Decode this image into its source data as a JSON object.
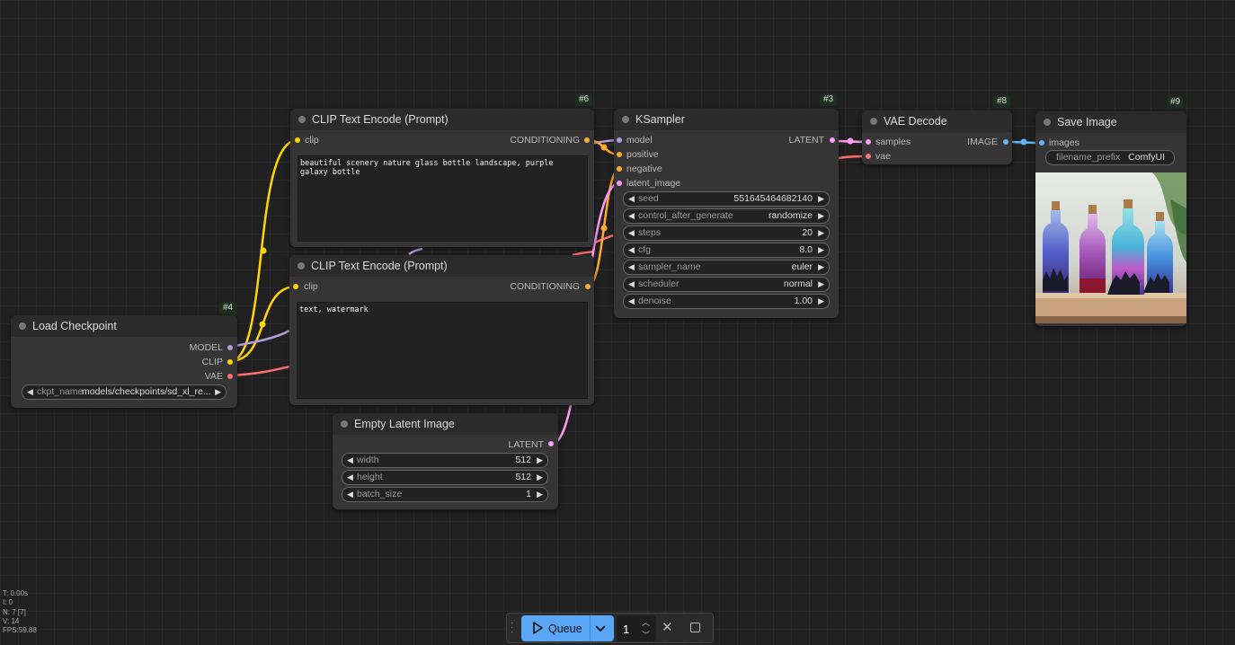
{
  "colors": {
    "model": "#b39ddb",
    "clip": "#ffd500",
    "vae": "#ff6e6e",
    "conditioning": "#ffa931",
    "latent": "#ff9cf9",
    "image": "#64b5f6",
    "queue_accent": "#58a6f5"
  },
  "nodes": {
    "load_checkpoint": {
      "badge": "#4",
      "title": "Load Checkpoint",
      "outputs": [
        "MODEL",
        "CLIP",
        "VAE"
      ],
      "ckpt_name_label": "ckpt_name",
      "ckpt_name_value": "models/checkpoints/sd_xl_re..."
    },
    "clip_pos": {
      "badge": "#6",
      "title": "CLIP Text Encode (Prompt)",
      "input": "clip",
      "output": "CONDITIONING",
      "text": "beautiful scenery nature glass bottle landscape, purple galaxy bottle"
    },
    "clip_neg": {
      "title": "CLIP Text Encode (Prompt)",
      "input": "clip",
      "output": "CONDITIONING",
      "text": "text, watermark"
    },
    "empty_latent": {
      "title": "Empty Latent Image",
      "output": "LATENT",
      "widgets": [
        {
          "name": "width",
          "value": "512"
        },
        {
          "name": "height",
          "value": "512"
        },
        {
          "name": "batch_size",
          "value": "1"
        }
      ]
    },
    "ksampler": {
      "badge": "#3",
      "title": "KSampler",
      "inputs": [
        "model",
        "positive",
        "negative",
        "latent_image"
      ],
      "output": "LATENT",
      "widgets": [
        {
          "name": "seed",
          "value": "551645464682140"
        },
        {
          "name": "control_after_generate",
          "value": "randomize"
        },
        {
          "name": "steps",
          "value": "20"
        },
        {
          "name": "cfg",
          "value": "8.0"
        },
        {
          "name": "sampler_name",
          "value": "euler"
        },
        {
          "name": "scheduler",
          "value": "normal"
        },
        {
          "name": "denoise",
          "value": "1.00"
        }
      ]
    },
    "vae_decode": {
      "badge": "#8",
      "title": "VAE Decode",
      "inputs": [
        "samples",
        "vae"
      ],
      "output": "IMAGE"
    },
    "save_image": {
      "badge": "#9",
      "title": "Save Image",
      "input": "images",
      "prefix_label": "filename_prefix",
      "prefix_value": "ComfyUI"
    }
  },
  "stats": [
    "T: 0.00s",
    "I: 0",
    "N: 7 [7]",
    "V: 14",
    "FPS:59.88"
  ],
  "queue": {
    "label": "Queue",
    "count": "1"
  }
}
